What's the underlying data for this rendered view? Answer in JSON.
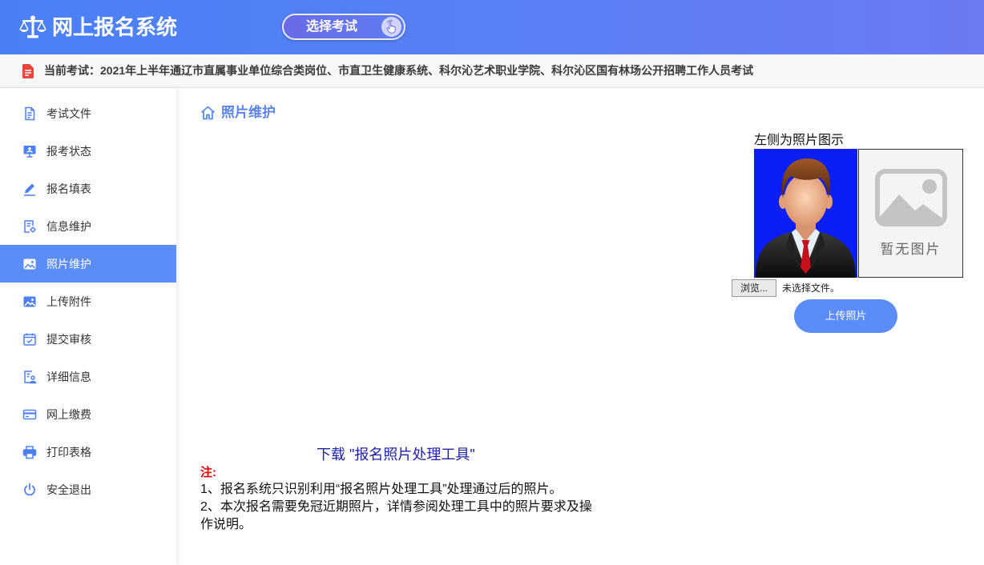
{
  "header": {
    "logo_icon": "scales-icon",
    "title": "网上报名系统",
    "select_exam_label": "选择考试",
    "select_exam_icon": "hand-pointer-icon"
  },
  "current_exam": {
    "icon": "document-icon",
    "text": "当前考试：2021年上半年通辽市直属事业单位综合类岗位、市直卫生健康系统、科尔沁艺术职业学院、科尔沁区国有林场公开招聘工作人员考试"
  },
  "sidebar": {
    "items": [
      {
        "label": "考试文件",
        "icon": "document-icon",
        "active": false
      },
      {
        "label": "报考状态",
        "icon": "monitor-icon",
        "active": false
      },
      {
        "label": "报名填表",
        "icon": "pencil-icon",
        "active": false
      },
      {
        "label": "信息维护",
        "icon": "document-gear-icon",
        "active": false
      },
      {
        "label": "照片维护",
        "icon": "image-icon",
        "active": true
      },
      {
        "label": "上传附件",
        "icon": "image-icon",
        "active": false
      },
      {
        "label": "提交审核",
        "icon": "calendar-check-icon",
        "active": false
      },
      {
        "label": "详细信息",
        "icon": "document-person-icon",
        "active": false
      },
      {
        "label": "网上缴费",
        "icon": "credit-card-icon",
        "active": false
      },
      {
        "label": "打印表格",
        "icon": "printer-icon",
        "active": false
      },
      {
        "label": "安全退出",
        "icon": "power-icon",
        "active": false
      }
    ]
  },
  "main": {
    "title_icon": "home-icon",
    "page_title": "照片维护",
    "photo": {
      "example_caption": "左侧为照片图示",
      "placeholder_icon": "image-placeholder-icon",
      "placeholder_text": "暂无图片",
      "browse_label": "浏览...",
      "no_file_text": "未选择文件。",
      "upload_label": "上传照片"
    },
    "download_link": "下载 \"报名照片处理工具\"",
    "notes": {
      "title": "注:",
      "lines": [
        "1、报名系统只识别利用“报名照片处理工具”处理通过后的照片。",
        "2、本次报名需要免冠近期照片，详情参阅处理工具中的照片要求及操作说明。"
      ]
    }
  },
  "colors": {
    "header_start": "#4a80f6",
    "header_end": "#6a7af1",
    "accent": "#5b8cf8",
    "note_red": "#e00000",
    "link_blue": "#2020a8"
  }
}
